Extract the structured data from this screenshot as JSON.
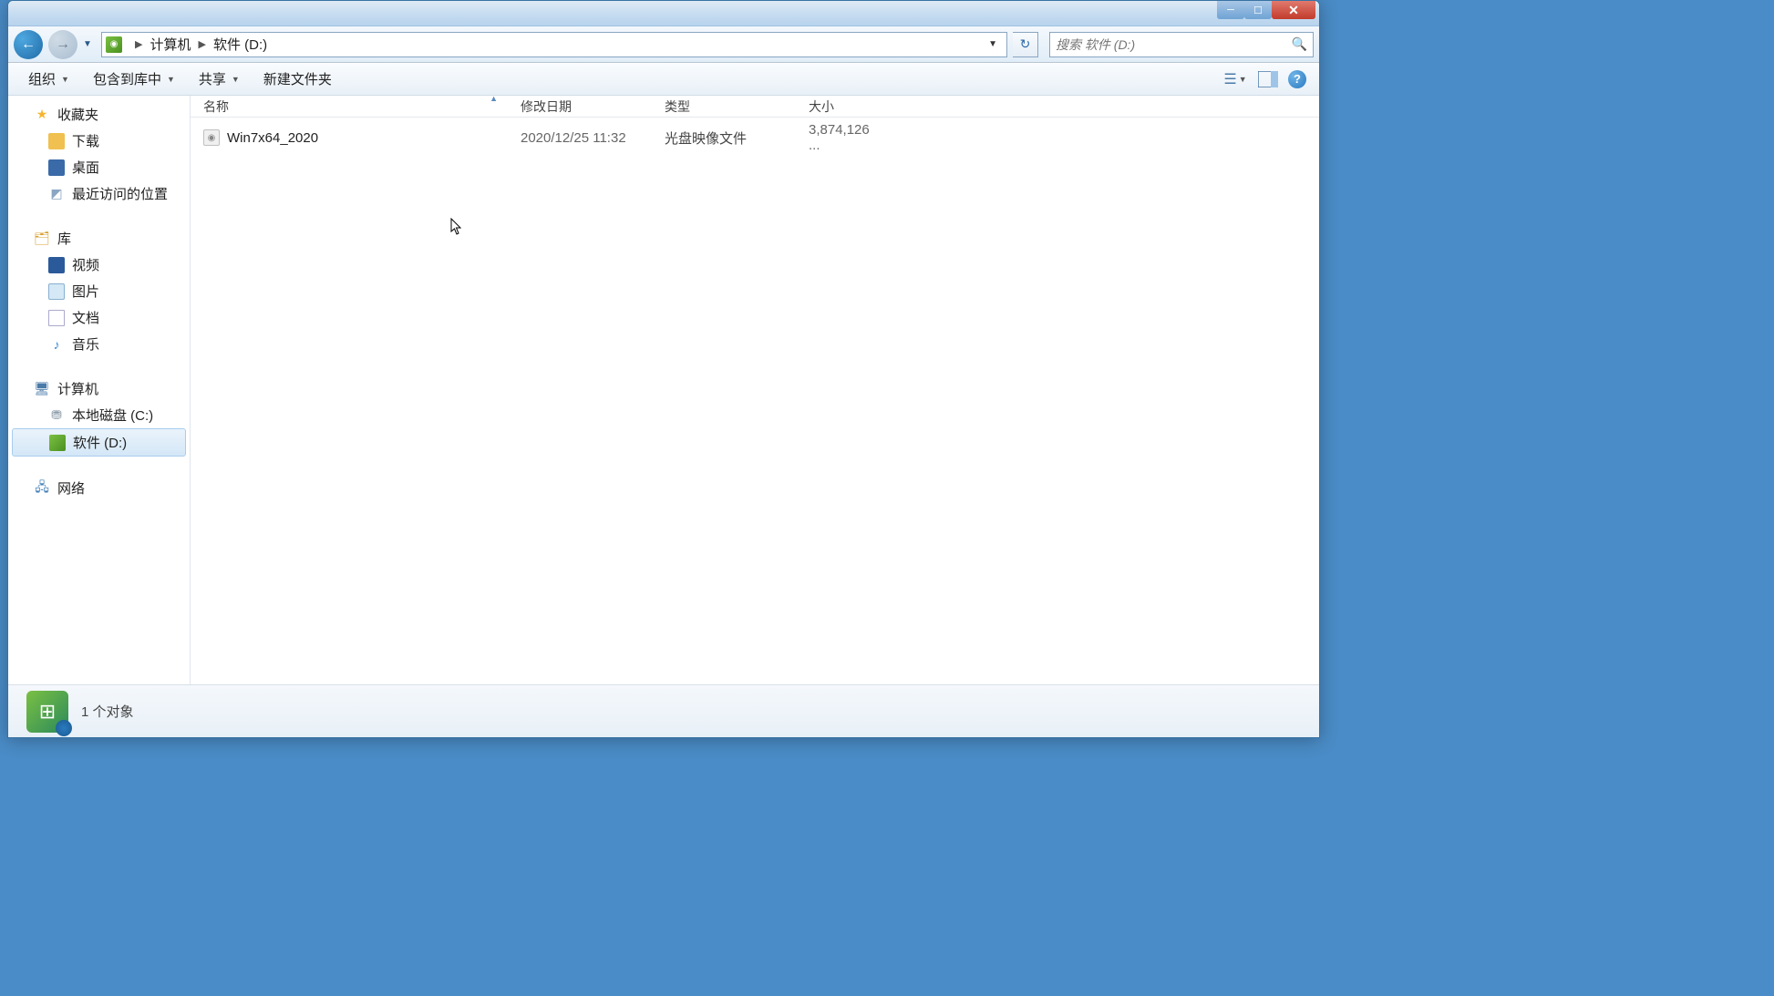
{
  "address": {
    "segments": [
      "计算机",
      "软件 (D:)"
    ]
  },
  "search": {
    "placeholder": "搜索 软件 (D:)"
  },
  "toolbar": {
    "organize": "组织",
    "include_library": "包含到库中",
    "share": "共享",
    "new_folder": "新建文件夹"
  },
  "columns": {
    "name": "名称",
    "date": "修改日期",
    "type": "类型",
    "size": "大小"
  },
  "sidebar": {
    "favorites": {
      "header": "收藏夹",
      "items": [
        "下载",
        "桌面",
        "最近访问的位置"
      ]
    },
    "libraries": {
      "header": "库",
      "items": [
        "视频",
        "图片",
        "文档",
        "音乐"
      ]
    },
    "computer": {
      "header": "计算机",
      "items": [
        "本地磁盘 (C:)",
        "软件 (D:)"
      ]
    },
    "network": {
      "header": "网络"
    }
  },
  "files": [
    {
      "name": "Win7x64_2020",
      "date": "2020/12/25 11:32",
      "type": "光盘映像文件",
      "size": "3,874,126 ..."
    }
  ],
  "status": {
    "text": "1 个对象"
  }
}
